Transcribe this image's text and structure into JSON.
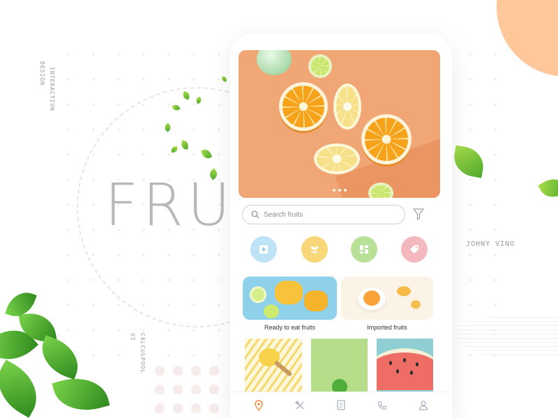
{
  "background": {
    "title_word": "FRUIT",
    "vertical_labels": [
      "DESIGN",
      "INTERACTION",
      "CALCULPOOL",
      "UI"
    ],
    "author": "JOHNY VINO"
  },
  "colors": {
    "accent_orange": "#f3a066",
    "blob": "#ffc79a",
    "cat_blue": "#bfe3f6",
    "cat_yellow": "#f7d778",
    "cat_green": "#b8e096",
    "cat_pink": "#f4b8bf",
    "nav_active": "#f08a3e"
  },
  "hero": {
    "carousel_dots": 3
  },
  "search": {
    "placeholder": "Search fruits",
    "value": ""
  },
  "categories": [
    {
      "name": "fresh",
      "icon": "tray-icon"
    },
    {
      "name": "organic",
      "icon": "sprout-icon"
    },
    {
      "name": "categories",
      "icon": "grid-icon"
    },
    {
      "name": "offers",
      "icon": "tag-icon"
    }
  ],
  "collections": [
    {
      "label": "Ready to eat fruits"
    },
    {
      "label": "Imported fruits"
    }
  ],
  "tiles": [
    {
      "name": "lemon-tile"
    },
    {
      "name": "lime-tile"
    },
    {
      "name": "watermelon-tile"
    }
  ],
  "nav": [
    {
      "icon": "location-pin-icon",
      "active": true
    },
    {
      "icon": "tools-icon",
      "active": false
    },
    {
      "icon": "list-icon",
      "active": false
    },
    {
      "icon": "phone-icon",
      "active": false
    },
    {
      "icon": "user-icon",
      "active": false
    }
  ]
}
